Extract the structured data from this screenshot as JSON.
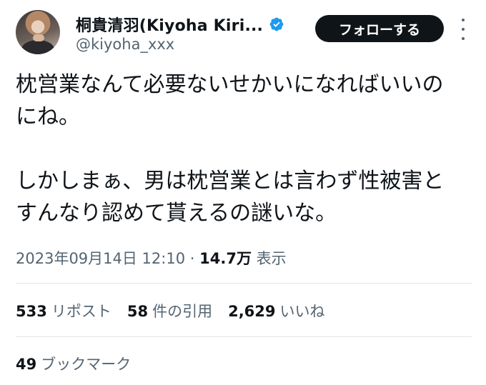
{
  "author": {
    "display_name": "桐貴清羽(Kiyoha Kiri...",
    "handle": "@kiyoha_xxx",
    "verified_icon": "verified-badge-icon",
    "verified_color": "#1d9bf0"
  },
  "follow_button": {
    "label": "フォローする"
  },
  "tweet": {
    "lines": [
      "枕営業なんて必要ないせかいになればいいの",
      "にね。",
      "",
      "しかしまぁ、男は枕営業とは言わず性被害と",
      "すんなり認めて貰えるの謎いな。"
    ]
  },
  "meta": {
    "datetime": "2023年09月14日 12:10",
    "separator": "·",
    "views": "14.7万",
    "views_label": "表示"
  },
  "stats": {
    "reposts": {
      "count": "533",
      "label": "リポスト"
    },
    "quotes": {
      "count": "58",
      "label": "件の引用"
    },
    "likes": {
      "count": "2,629",
      "label": "いいね"
    }
  },
  "bookmarks": {
    "count": "49",
    "label": "ブックマーク"
  }
}
